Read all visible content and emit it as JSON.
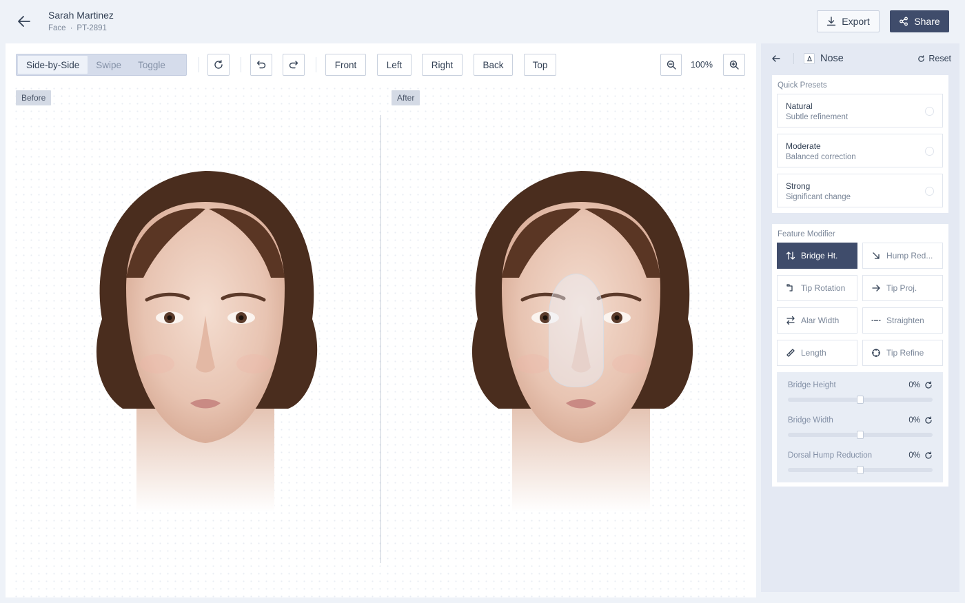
{
  "header": {
    "patient_name": "Sarah Martinez",
    "category": "Face",
    "separator": "·",
    "patient_id": "PT-2891",
    "export_label": "Export",
    "share_label": "Share"
  },
  "toolbar": {
    "view_modes": [
      "Side-by-Side",
      "Swipe",
      "Toggle"
    ],
    "active_view_mode": "Side-by-Side",
    "views": [
      "Front",
      "Left",
      "Right",
      "Back",
      "Top"
    ],
    "zoom": "100%"
  },
  "canvas": {
    "before_label": "Before",
    "after_label": "After"
  },
  "panel": {
    "title": "Nose",
    "title_icon": "nose-icon",
    "reset_label": "Reset",
    "quick_presets": {
      "label": "Quick Presets",
      "items": [
        {
          "title": "Natural",
          "subtitle": "Subtle refinement",
          "selected": false
        },
        {
          "title": "Moderate",
          "subtitle": "Balanced correction",
          "selected": false
        },
        {
          "title": "Strong",
          "subtitle": "Significant change",
          "selected": false
        }
      ]
    },
    "feature_modifier": {
      "label": "Feature Modifier",
      "items": [
        {
          "label": "Bridge Ht.",
          "icon": "arrows-up-down-icon",
          "active": true
        },
        {
          "label": "Hump Red...",
          "icon": "arrow-down-right-icon",
          "active": false
        },
        {
          "label": "Tip Rotation",
          "icon": "rotate-icon",
          "active": false
        },
        {
          "label": "Tip Proj.",
          "icon": "arrow-right-icon",
          "active": false
        },
        {
          "label": "Alar Width",
          "icon": "arrows-left-right-icon",
          "active": false
        },
        {
          "label": "Straighten",
          "icon": "line-icon",
          "active": false
        },
        {
          "label": "Length",
          "icon": "ruler-icon",
          "active": false
        },
        {
          "label": "Tip Refine",
          "icon": "crosshair-icon",
          "active": false
        }
      ]
    },
    "sliders": [
      {
        "label": "Bridge Height",
        "value": "0%",
        "fraction": 0.5
      },
      {
        "label": "Bridge Width",
        "value": "0%",
        "fraction": 0.5
      },
      {
        "label": "Dorsal Hump Reduction",
        "value": "0%",
        "fraction": 0.5
      }
    ]
  },
  "colors": {
    "accent": "#3f4c6b",
    "background": "#eef2f8",
    "panel": "#e4e9f3"
  }
}
